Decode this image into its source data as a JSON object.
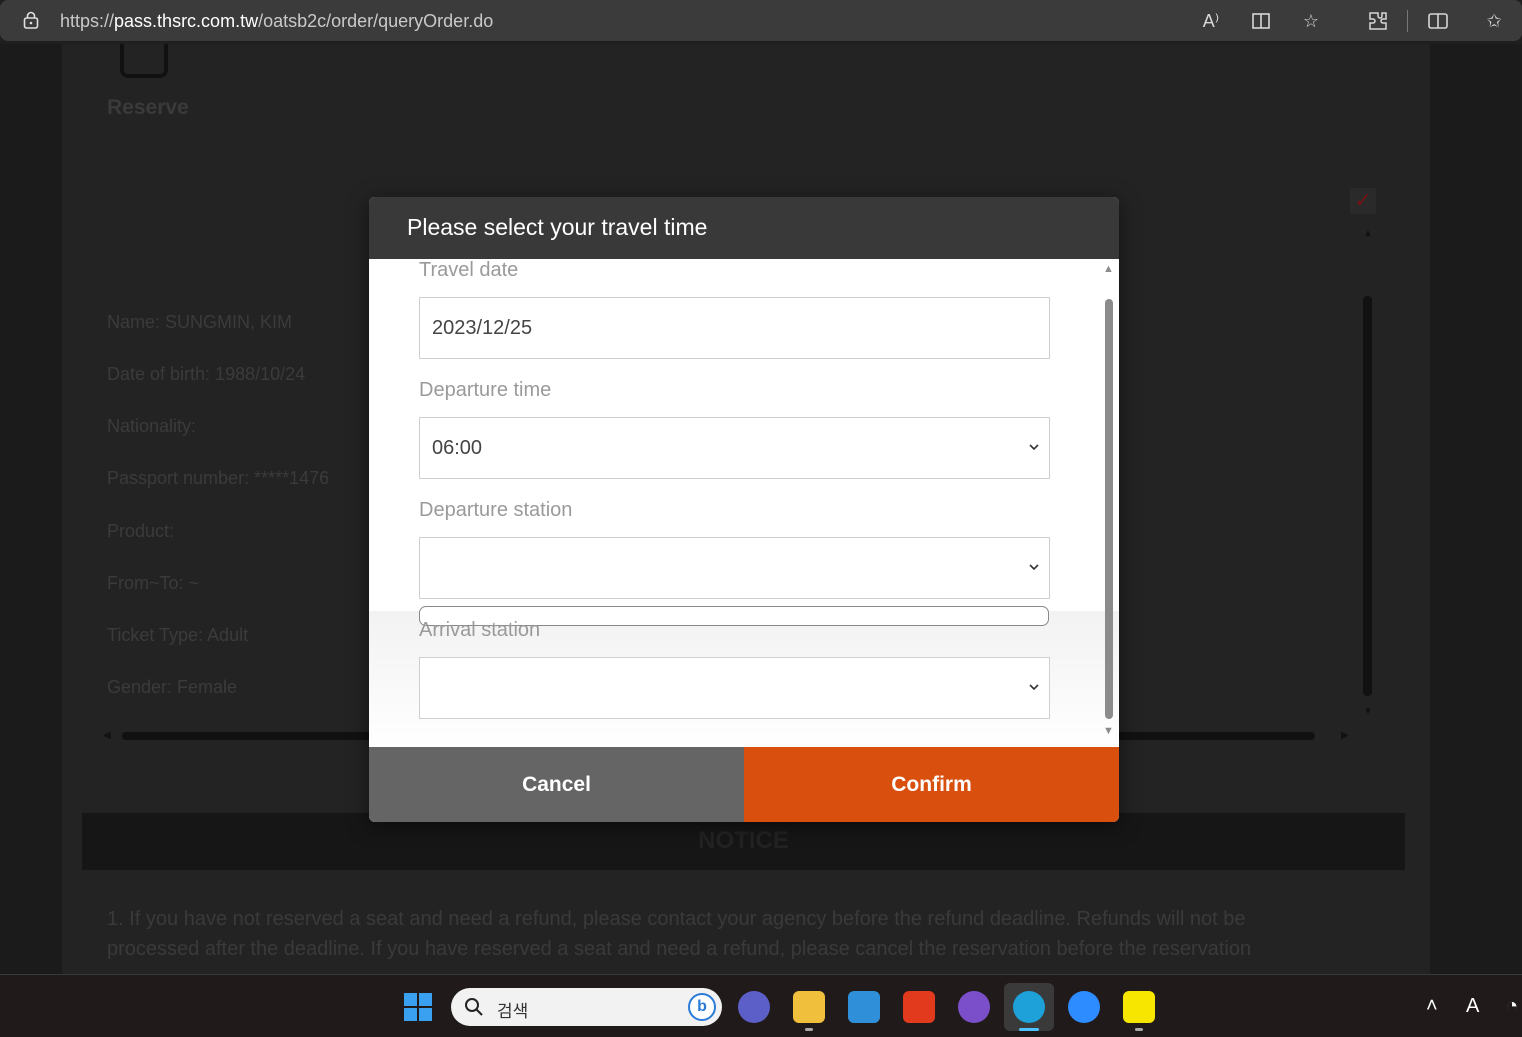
{
  "browser": {
    "url_prefix": "https://",
    "url_host": "pass.thsrc.com.tw",
    "url_path": "/oatsb2c/order/queryOrder.do"
  },
  "background_page": {
    "reserve_label": "Reserve",
    "info_lines": [
      "Name: SUNGMIN, KIM",
      "Date of birth: 1988/10/24",
      "Nationality:",
      "Passport number: *****1476",
      "Product:",
      "From~To: ~",
      "Ticket Type: Adult",
      "Gender: Female"
    ],
    "notice_title": "NOTICE",
    "notice_text": "1. If you have not reserved a seat and need a refund, please contact your agency before the refund deadline. Refunds will not be processed after the deadline. If you have reserved a seat and need a refund, please cancel the reservation before the reservation"
  },
  "modal": {
    "title": "Please select your travel time",
    "travel_date_label": "Travel date",
    "travel_date_value": "2023/12/25",
    "departure_time_label": "Departure time",
    "departure_time_value": "06:00",
    "departure_station_label": "Departure station",
    "departure_station_value": "",
    "arrival_station_label": "Arrival station",
    "arrival_station_value": "",
    "cancel_label": "Cancel",
    "confirm_label": "Confirm"
  },
  "taskbar": {
    "search_text": "검색"
  },
  "colors": {
    "confirm": "#d9500e",
    "cancel": "#656565",
    "header": "#393939"
  }
}
